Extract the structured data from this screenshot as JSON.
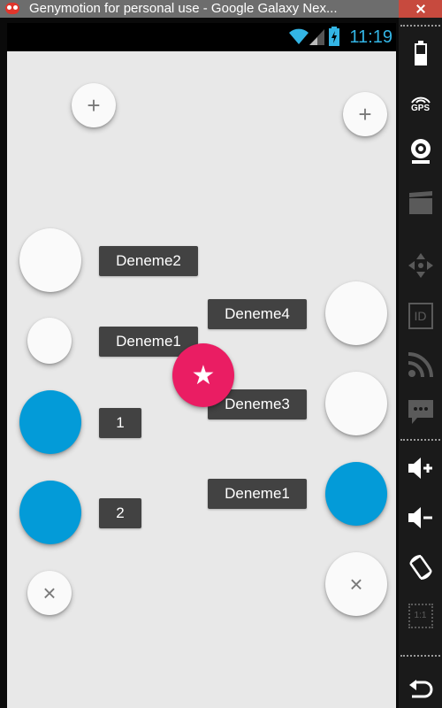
{
  "window": {
    "title": "Genymotion for personal use - Google Galaxy Nex..."
  },
  "statusbar": {
    "time": "11:19",
    "accent_color": "#33b5e5"
  },
  "colors": {
    "screen_bg": "#e8e8e8",
    "fab_white": "#fafafa",
    "fab_blue": "#039bd8",
    "fab_pink": "#ea1d63",
    "label_bg": "#424242"
  },
  "left_menu": {
    "plus_icon": "+",
    "items": [
      {
        "label": "Deneme2",
        "color": "white"
      },
      {
        "label": "Deneme1",
        "color": "white"
      },
      {
        "label": "1",
        "color": "blue"
      },
      {
        "label": "2",
        "color": "blue"
      }
    ],
    "close_icon": "×"
  },
  "right_menu": {
    "plus_icon": "+",
    "items": [
      {
        "label": "Deneme4",
        "color": "white"
      },
      {
        "label": "Deneme3",
        "color": "white"
      },
      {
        "label": "Deneme1",
        "color": "blue"
      }
    ],
    "close_icon": "×"
  },
  "center_fab": {
    "icon": "★",
    "color": "#ea1d63"
  },
  "toolbar_icons": [
    "battery-icon",
    "gps-icon",
    "camera-icon",
    "video-icon",
    "dpad-icon",
    "id-icon",
    "rss-icon",
    "sms-icon",
    "volume-up-icon",
    "volume-down-icon",
    "rotate-icon",
    "scale-icon",
    "back-icon"
  ],
  "toolbar_labels": {
    "gps": "GPS",
    "id": "ID",
    "scale": "1:1"
  }
}
